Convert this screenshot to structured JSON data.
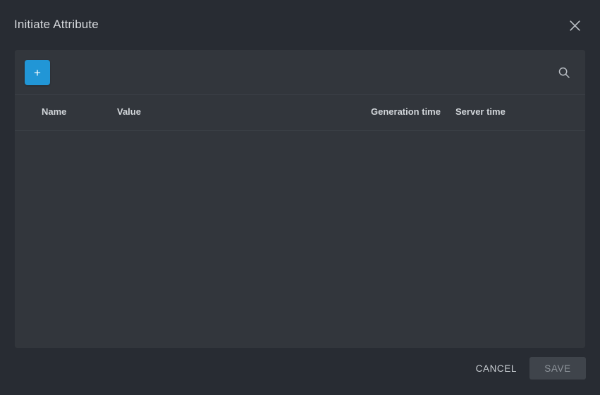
{
  "dialog": {
    "title": "Initiate Attribute",
    "close_icon": "close-icon"
  },
  "toolbar": {
    "add_label": "+",
    "add_icon": "plus-icon",
    "search_icon": "search-icon"
  },
  "table": {
    "columns": [
      {
        "key": "name",
        "label": "Name"
      },
      {
        "key": "value",
        "label": "Value"
      },
      {
        "key": "generation_time",
        "label": "Generation time"
      },
      {
        "key": "server_time",
        "label": "Server time"
      }
    ],
    "rows": []
  },
  "footer": {
    "cancel_label": "CANCEL",
    "save_label": "SAVE"
  },
  "colors": {
    "dialog_background": "#282c33",
    "card_background": "#32363c",
    "accent_blue": "#2196d6",
    "divider": "#3a3f46",
    "text_primary": "#d6d9dd",
    "text_muted": "#8d939a",
    "save_disabled_background": "#3f444b"
  }
}
